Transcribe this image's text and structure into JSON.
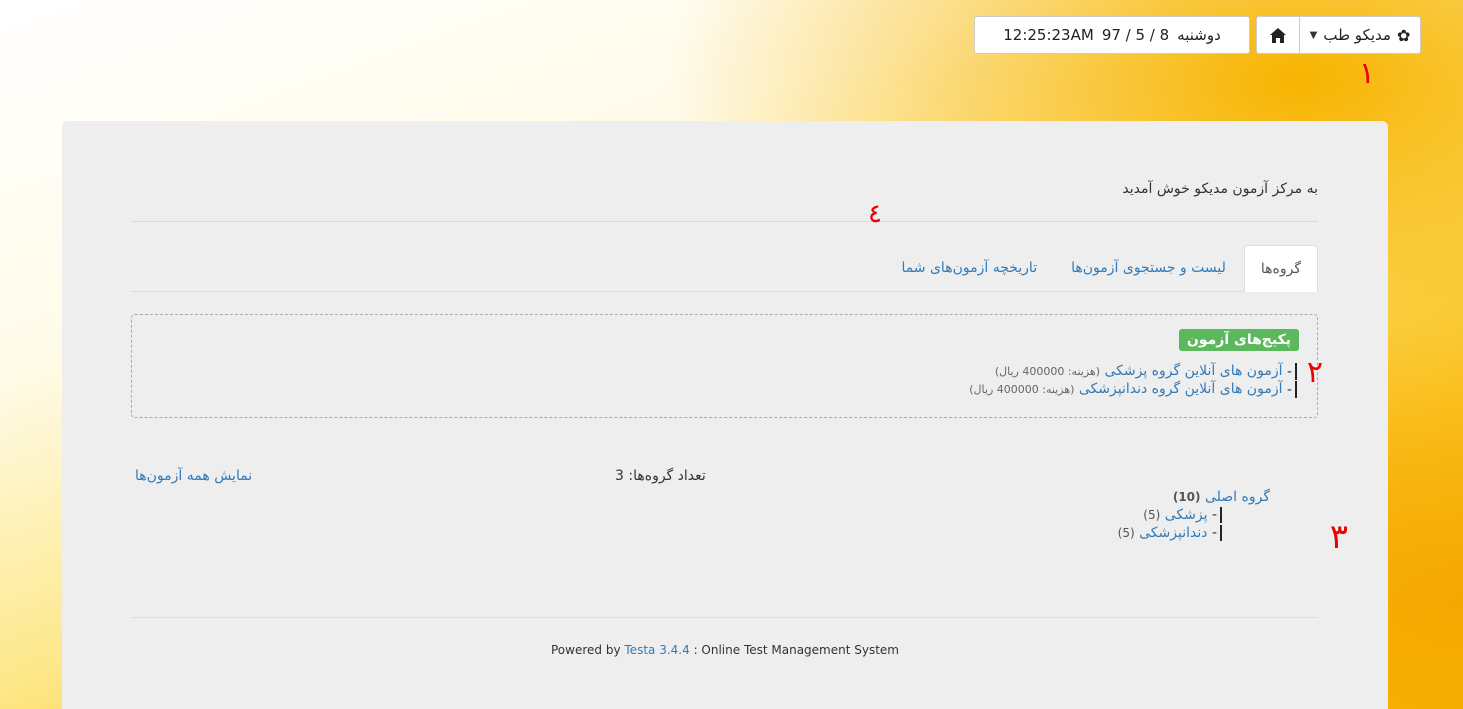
{
  "header": {
    "datetime": "12:25:23AM 97 / 5 / 8 دوشنبه",
    "time": "12:25:23AM",
    "date": "97 / 5 / 8",
    "weekday": "دوشنبه",
    "user_label": "مدیکو طب",
    "home_icon": "home-icon",
    "gear_icon": "gear-icon"
  },
  "annotations": {
    "a1": "١",
    "a2": "٢",
    "a3": "٣",
    "a4": "٤"
  },
  "main": {
    "welcome": "به مرکز آزمون مدیکو خوش آمدید",
    "tabs": [
      {
        "label": "گروه‌ها",
        "active": true
      },
      {
        "label": "لیست و جستجوی آزمون‌ها",
        "active": false
      },
      {
        "label": "تاریخچه آزمون‌های شما",
        "active": false
      }
    ],
    "packages": {
      "title": "پکیج‌های آزمون",
      "items": [
        {
          "name": "آزمون های آنلاین گروه پزشکی",
          "cost": "(هزینه: 400000 ریال)"
        },
        {
          "name": "آزمون های آنلاین گروه دندانپزشکی",
          "cost": "(هزینه: 400000 ریال)"
        }
      ]
    },
    "groups_count": "تعداد گروه‌ها: 3",
    "show_all": "نمایش همه آزمون‌ها",
    "groups": {
      "main": {
        "name": "گروه اصلی",
        "count": "(10)"
      },
      "children": [
        {
          "name": "پزشکی",
          "count": "(5)"
        },
        {
          "name": "دندانپزشکی",
          "count": "(5)"
        }
      ]
    }
  },
  "footer": {
    "powered_by": "Powered by",
    "product": "Testa 3.4.4",
    "tagline": ": Online Test Management System"
  }
}
